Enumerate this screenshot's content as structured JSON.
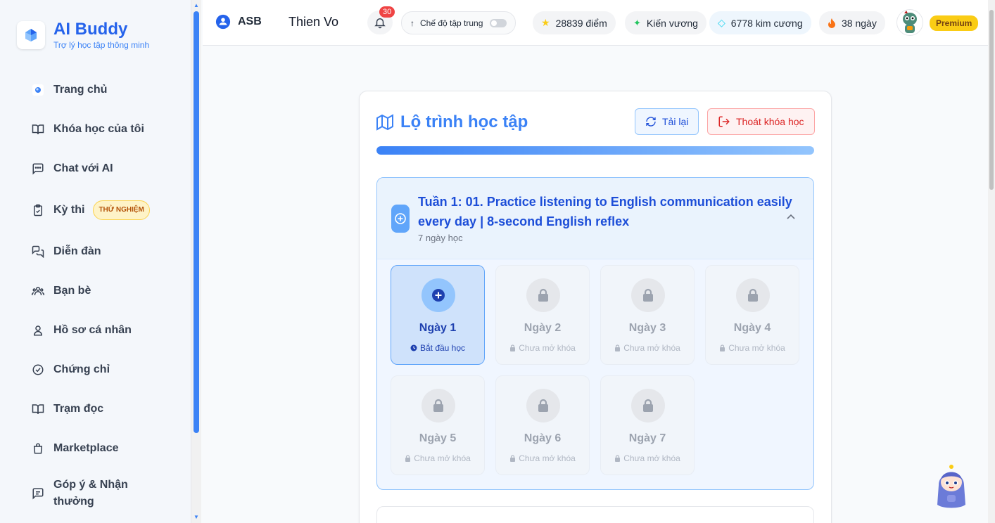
{
  "brand": {
    "name": "AI Buddy",
    "tagline": "Trợ lý học tập thông minh"
  },
  "sidebar": {
    "items": [
      {
        "label": "Trang chủ",
        "icon": "home-logo-icon"
      },
      {
        "label": "Khóa học của tôi",
        "icon": "book-open-icon"
      },
      {
        "label": "Chat với AI",
        "icon": "chat-icon"
      },
      {
        "label": "Kỳ thi",
        "icon": "clipboard-check-icon",
        "badge": "THỬ NGHIỆM"
      },
      {
        "label": "Diễn đàn",
        "icon": "forum-icon"
      },
      {
        "label": "Bạn bè",
        "icon": "users-icon"
      },
      {
        "label": "Hồ sơ cá nhân",
        "icon": "user-icon"
      },
      {
        "label": "Chứng chỉ",
        "icon": "check-circle-icon"
      },
      {
        "label": "Trạm đọc",
        "icon": "book-open-icon"
      },
      {
        "label": "Marketplace",
        "icon": "shopping-bag-icon"
      },
      {
        "label": "Góp ý & Nhận thưởng",
        "icon": "feedback-icon"
      }
    ]
  },
  "header": {
    "org": "ASB",
    "user": "Thien Vo",
    "notifications": "30",
    "focus_mode": "Chế độ tập trung",
    "points": "28839 điểm",
    "rank": "Kiến vương",
    "gems": "6778 kim cương",
    "streak": "38 ngày",
    "plan": "Premium"
  },
  "roadmap": {
    "title": "Lộ trình học tập",
    "reload_label": "Tải lại",
    "exit_label": "Thoát khóa học",
    "progress": 1.0,
    "week": {
      "title": "Tuần 1: 01. Practice listening to English communication easily every day | 8-second English reflex",
      "subtitle": "7 ngày học",
      "days": [
        {
          "label": "Ngày 1",
          "status": "Bắt đầu học",
          "active": true
        },
        {
          "label": "Ngày 2",
          "status": "Chưa mở khóa",
          "active": false
        },
        {
          "label": "Ngày 3",
          "status": "Chưa mở khóa",
          "active": false
        },
        {
          "label": "Ngày 4",
          "status": "Chưa mở khóa",
          "active": false
        },
        {
          "label": "Ngày 5",
          "status": "Chưa mở khóa",
          "active": false
        },
        {
          "label": "Ngày 6",
          "status": "Chưa mở khóa",
          "active": false
        },
        {
          "label": "Ngày 7",
          "status": "Chưa mở khóa",
          "active": false
        }
      ]
    }
  },
  "colors": {
    "accent": "#3b82f6",
    "danger": "#dc2626",
    "premium": "#facc15"
  }
}
